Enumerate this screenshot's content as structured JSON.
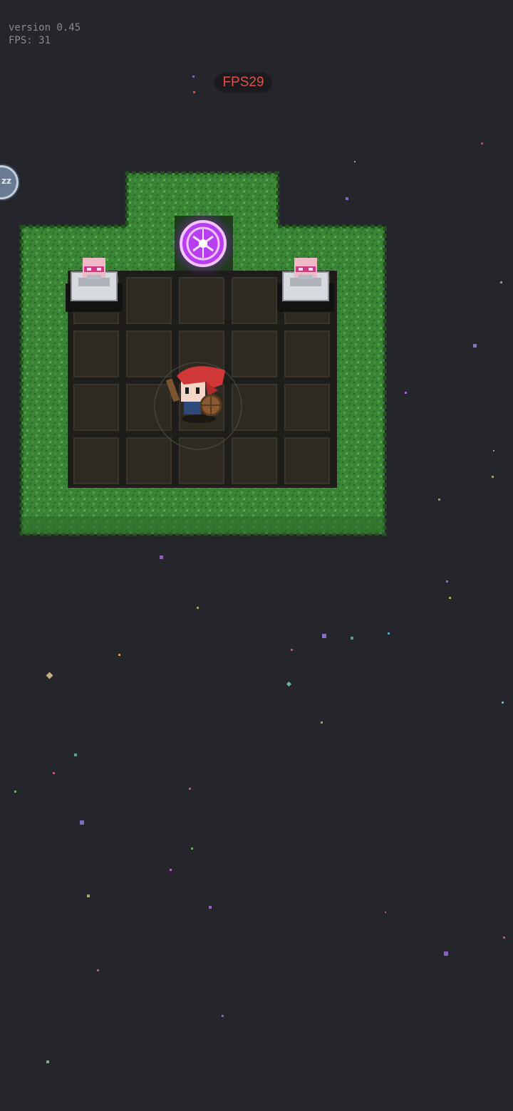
{
  "hud": {
    "version_text": "version 0.45",
    "fps_debug_text": "FPS: 31",
    "fps_pill_text": "FPS29",
    "sleep_button_text": "zz",
    "fps_color": "#e0504a"
  },
  "room": {
    "grass_color": "#3c8a3a",
    "floor_color": "#2e2a22",
    "portal_color": "#c23cff"
  },
  "icons": [
    "moon-icon",
    "portal-icon",
    "skull-altar-icon",
    "player-knight-icon"
  ]
}
